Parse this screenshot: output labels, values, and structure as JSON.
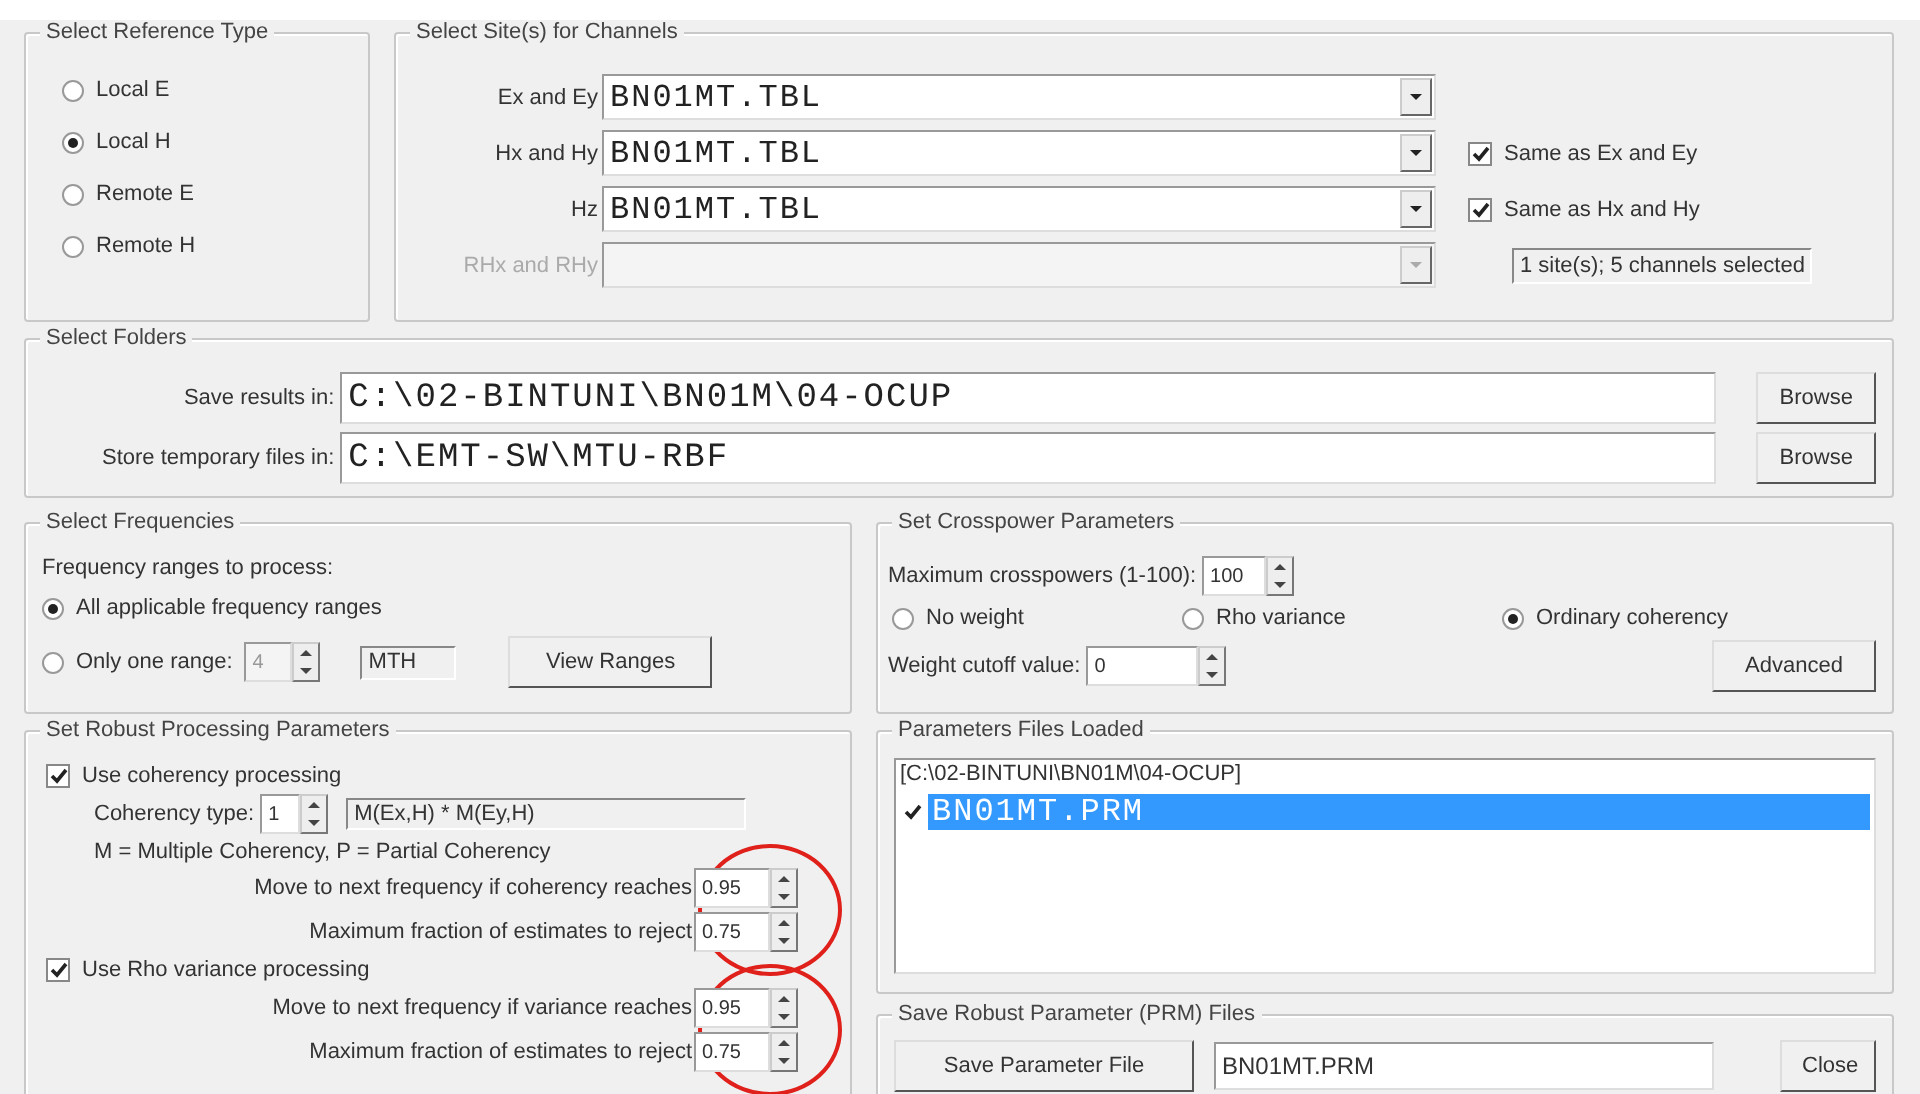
{
  "reference_type": {
    "title": "Select Reference Type",
    "options": [
      {
        "label": "Local E",
        "selected": false
      },
      {
        "label": "Local H",
        "selected": true
      },
      {
        "label": "Remote E",
        "selected": false
      },
      {
        "label": "Remote H",
        "selected": false
      }
    ]
  },
  "sites": {
    "title": "Select Site(s) for Channels",
    "rows": [
      {
        "label": "Ex and Ey",
        "value": "BN01MT.TBL",
        "disabled": false
      },
      {
        "label": "Hx and Hy",
        "value": "BN01MT.TBL",
        "disabled": false,
        "checkbox": {
          "label": "Same as Ex and Ey",
          "checked": true
        }
      },
      {
        "label": "Hz",
        "value": "BN01MT.TBL",
        "disabled": false,
        "checkbox": {
          "label": "Same as Hx and Hy",
          "checked": true
        }
      },
      {
        "label": "RHx and RHy",
        "disabled": true
      }
    ],
    "status": "1 site(s); 5 channels selected"
  },
  "folders": {
    "title": "Select Folders",
    "rows": [
      {
        "label": "Save results in:",
        "value": "C:\\02-BINTUNI\\BN01M\\04-OCUP",
        "button": "Browse"
      },
      {
        "label": "Store temporary files in:",
        "value": "C:\\EMT-SW\\MTU-RBF",
        "button": "Browse"
      }
    ]
  },
  "frequencies": {
    "title": "Select Frequencies",
    "caption": "Frequency ranges to process:",
    "options": [
      {
        "label": "All applicable frequency ranges",
        "selected": true
      },
      {
        "label": "Only one range:",
        "selected": false
      }
    ],
    "range_value": "4",
    "range_disabled": true,
    "range_name": "MTH",
    "button": "View Ranges"
  },
  "crosspower": {
    "title": "Set Crosspower Parameters",
    "max_label": "Maximum crosspowers (1-100):",
    "max_value": "100",
    "weights": [
      {
        "label": "No weight",
        "selected": false
      },
      {
        "label": "Rho variance",
        "selected": false
      },
      {
        "label": "Ordinary coherency",
        "selected": true
      }
    ],
    "cutoff_label": "Weight cutoff value:",
    "cutoff_value": "0",
    "button": "Advanced"
  },
  "robust": {
    "title": "Set Robust Processing Parameters",
    "coherency": {
      "label": "Use coherency processing",
      "checked": true,
      "type_label": "Coherency type:",
      "type_value": "1",
      "type_formula": "M(Ex,H) * M(Ey,H)",
      "note": "M = Multiple Coherency, P = Partial Coherency",
      "circled": true,
      "params": [
        {
          "label": "Move to next frequency if coherency reaches",
          "value": "0.95"
        },
        {
          "label": "Maximum fraction of estimates to reject",
          "value": "0.75"
        }
      ]
    },
    "rho": {
      "label": "Use Rho variance processing",
      "checked": true,
      "circled": true,
      "params": [
        {
          "label": "Move to next frequency if variance reaches",
          "value": "0.95"
        },
        {
          "label": "Maximum fraction of estimates to reject",
          "value": "0.75"
        }
      ]
    }
  },
  "params_files": {
    "title": "Parameters Files Loaded",
    "folder": "[C:\\02-BINTUNI\\BN01M\\04-OCUP]",
    "items": [
      {
        "name": "BN01MT.PRM",
        "checked": true,
        "selected": true
      }
    ]
  },
  "save_prm": {
    "title": "Save Robust Parameter (PRM) Files",
    "button": "Save Parameter File",
    "filename": "BN01MT.PRM",
    "close": "Close"
  }
}
